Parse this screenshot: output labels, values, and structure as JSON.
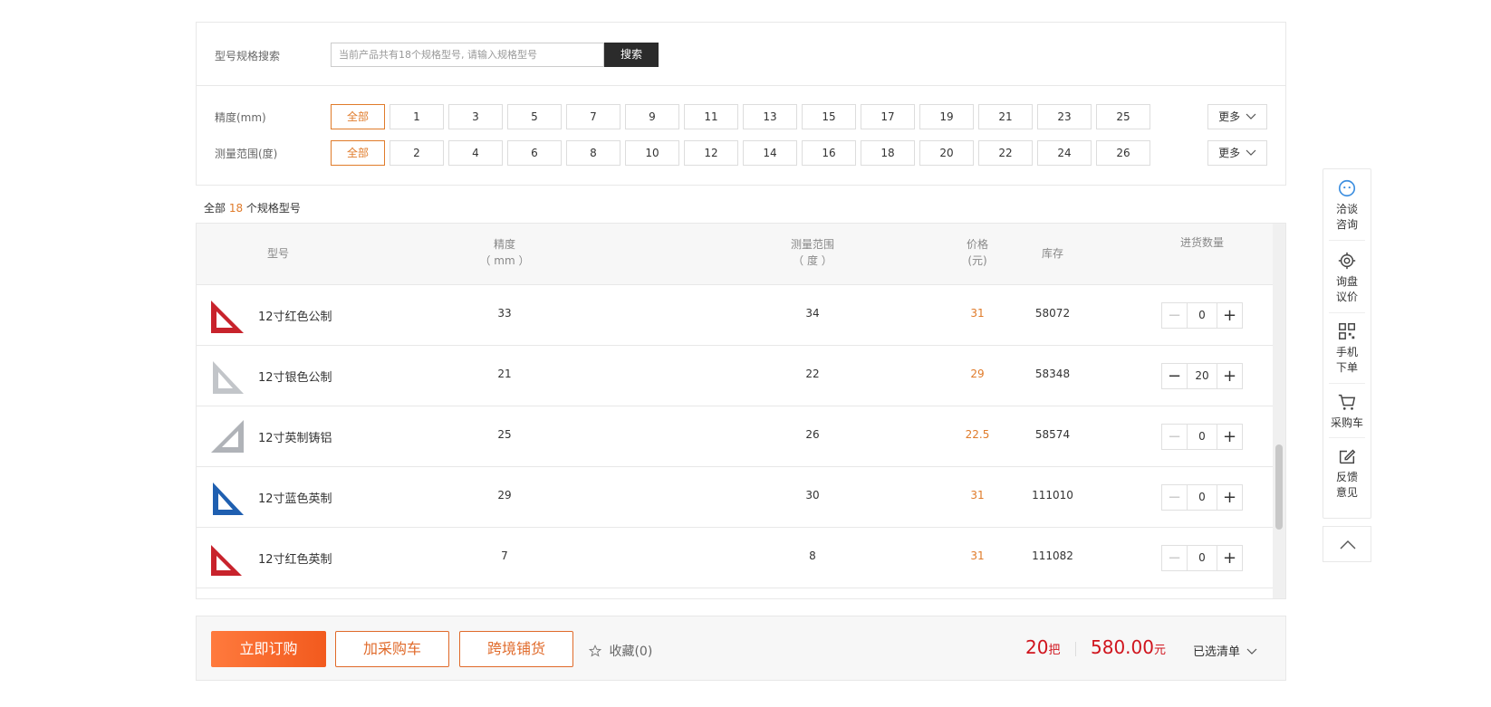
{
  "search": {
    "label": "型号规格搜索",
    "placeholder": "当前产品共有18个规格型号, 请输入规格型号",
    "button": "搜索"
  },
  "filters": [
    {
      "label": "精度(mm)",
      "options": [
        "全部",
        "1",
        "3",
        "5",
        "7",
        "9",
        "11",
        "13",
        "15",
        "17",
        "19",
        "21",
        "23",
        "25"
      ],
      "selected": "全部",
      "more": "更多"
    },
    {
      "label": "测量范围(度)",
      "options": [
        "全部",
        "2",
        "4",
        "6",
        "8",
        "10",
        "12",
        "14",
        "16",
        "18",
        "20",
        "22",
        "24",
        "26"
      ],
      "selected": "全部",
      "more": "更多"
    }
  ],
  "summary": {
    "prefix": "全部 ",
    "count": "18",
    "suffix": " 个规格型号"
  },
  "table": {
    "headers": {
      "model": "型号",
      "precision": "精度",
      "precision_unit": "（ mm ）",
      "range": "测量范围",
      "range_unit": "（ 度 ）",
      "price": "价格",
      "price_unit": "(元)",
      "stock": "库存",
      "qty": "进货数量"
    },
    "rows": [
      {
        "name": "12寸红色公制",
        "precision": "33",
        "range": "34",
        "price": "31",
        "stock": "58072",
        "qty": "0",
        "thumb_color": "#c8232c"
      },
      {
        "name": "12寸银色公制",
        "precision": "21",
        "range": "22",
        "price": "29",
        "stock": "58348",
        "qty": "20",
        "thumb_color": "#b9bcc0"
      },
      {
        "name": "12寸英制铸铝",
        "precision": "25",
        "range": "26",
        "price": "22.5",
        "stock": "58574",
        "qty": "0",
        "thumb_color": "#a8abb0"
      },
      {
        "name": "12寸蓝色英制",
        "precision": "29",
        "range": "30",
        "price": "31",
        "stock": "111010",
        "qty": "0",
        "thumb_color": "#1f5fb0"
      },
      {
        "name": "12寸红色英制",
        "precision": "7",
        "range": "8",
        "price": "31",
        "stock": "111082",
        "qty": "0",
        "thumb_color": "#c8232c"
      }
    ]
  },
  "actions": {
    "buy_now": "立即订购",
    "add_cart": "加采购车",
    "cross_border": "跨境铺货",
    "favorite": "收藏(0)"
  },
  "totals": {
    "qty": "20",
    "qty_unit": "把",
    "price": "580.00",
    "price_unit": "元",
    "selected_list": "已选清单"
  },
  "side_panel": {
    "items": [
      {
        "label1": "洽谈",
        "label2": "咨询",
        "icon": "chat-icon"
      },
      {
        "label1": "询盘",
        "label2": "议价",
        "icon": "target-icon"
      },
      {
        "label1": "手机",
        "label2": "下单",
        "icon": "qrcode-icon"
      },
      {
        "label1": "采购车",
        "label2": "",
        "icon": "cart-icon"
      },
      {
        "label1": "反馈",
        "label2": "意见",
        "icon": "edit-icon"
      }
    ],
    "back_top_icon": "chevron-up-icon"
  },
  "colors": {
    "accent": "#e07b2a",
    "total_red": "#d0141d",
    "buy_button": "#f25a1e"
  }
}
